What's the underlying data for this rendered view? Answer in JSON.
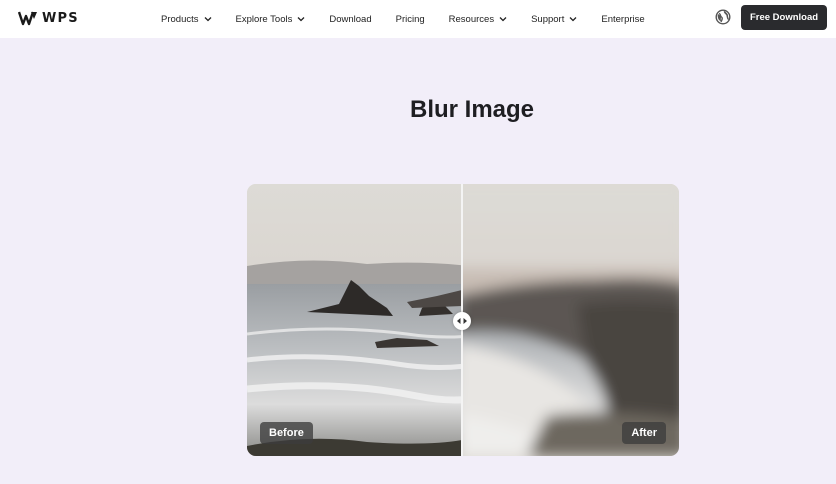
{
  "brand": {
    "name": "WPS"
  },
  "nav": {
    "items": [
      {
        "label": "Products",
        "has_dropdown": true
      },
      {
        "label": "Explore Tools",
        "has_dropdown": true
      },
      {
        "label": "Download",
        "has_dropdown": false
      },
      {
        "label": "Pricing",
        "has_dropdown": false
      },
      {
        "label": "Resources",
        "has_dropdown": true
      },
      {
        "label": "Support",
        "has_dropdown": true
      },
      {
        "label": "Enterprise",
        "has_dropdown": false
      }
    ],
    "globe_icon": "globe-icon",
    "cta_label": "Free Download"
  },
  "hero": {
    "title": "Blur Image"
  },
  "comparison": {
    "before_label": "Before",
    "after_label": "After",
    "handle_icon": "arrows-left-right-icon",
    "split_fraction": 0.5
  },
  "colors": {
    "page_background": "#f2eef9",
    "nav_background": "#ffffff",
    "cta_background": "#2a2b2e",
    "cta_text": "#ffffff"
  }
}
